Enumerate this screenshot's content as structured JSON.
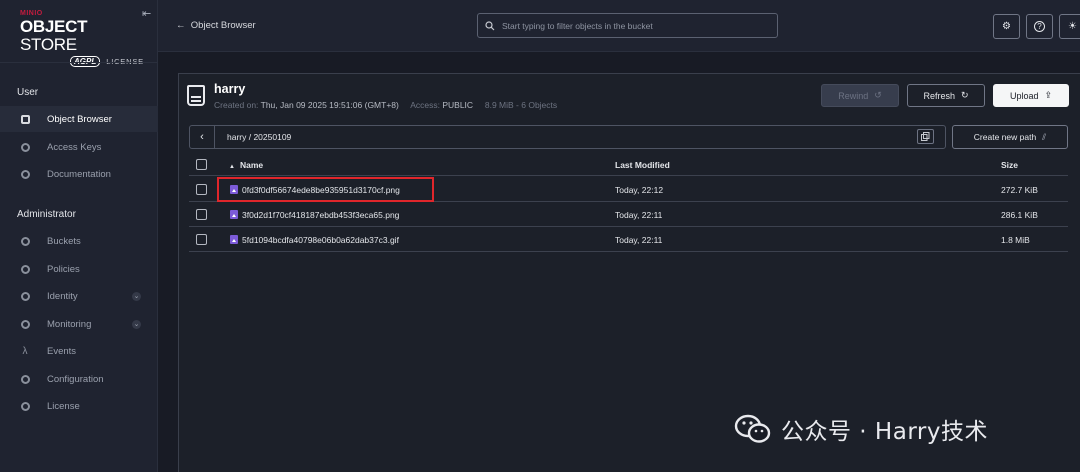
{
  "brand": {
    "vendor": "MINIO",
    "title_bold": "OBJECT",
    "title_thin": "STORE",
    "badge": "AGPL",
    "license_word": "LICENSE"
  },
  "sidebar": {
    "user_heading": "User",
    "user_items": [
      {
        "label": "Object Browser",
        "icon": "bucket-icon",
        "active": true
      },
      {
        "label": "Access Keys",
        "icon": "key-icon"
      },
      {
        "label": "Documentation",
        "icon": "doc-icon"
      }
    ],
    "admin_heading": "Administrator",
    "admin_items": [
      {
        "label": "Buckets",
        "icon": "buckets-icon"
      },
      {
        "label": "Policies",
        "icon": "policy-icon"
      },
      {
        "label": "Identity",
        "icon": "identity-icon",
        "expandable": true
      },
      {
        "label": "Monitoring",
        "icon": "monitoring-icon",
        "expandable": true
      },
      {
        "label": "Events",
        "icon": "lambda-icon"
      },
      {
        "label": "Configuration",
        "icon": "config-icon"
      },
      {
        "label": "License",
        "icon": "license-icon"
      }
    ]
  },
  "topbar": {
    "breadcrumb": "Object Browser",
    "search_placeholder": "Start typing to filter objects in the bucket"
  },
  "bucket": {
    "name": "harry",
    "created_label": "Created on:",
    "created_value": "Thu, Jan 09 2025 19:51:06 (GMT+8)",
    "access_label": "Access:",
    "access_value": "PUBLIC",
    "usage": "8.9 MiB - 6 Objects"
  },
  "actions": {
    "rewind": "Rewind",
    "refresh": "Refresh",
    "upload": "Upload",
    "create_path": "Create new path"
  },
  "path": "harry / 20250109",
  "table": {
    "columns": {
      "name": "Name",
      "modified": "Last Modified",
      "size": "Size"
    },
    "rows": [
      {
        "name": "0fd3f0df56674ede8be935951d3170cf.png",
        "modified": "Today, 22:12",
        "size": "272.7 KiB",
        "highlighted": true
      },
      {
        "name": "3f0d2d1f70cf418187ebdb453f3eca65.png",
        "modified": "Today, 22:11",
        "size": "286.1 KiB"
      },
      {
        "name": "5fd1094bcdfa40798e06b0a62dab37c3.gif",
        "modified": "Today, 22:11",
        "size": "1.8 MiB"
      }
    ]
  },
  "colors": {
    "background": "#181b25",
    "sidebar": "#1f2330",
    "accent_red": "#c51c3f",
    "file_icon": "#7c5bd8",
    "highlight_box": "#e0262b"
  },
  "watermark": "公众号 · Harry技术"
}
